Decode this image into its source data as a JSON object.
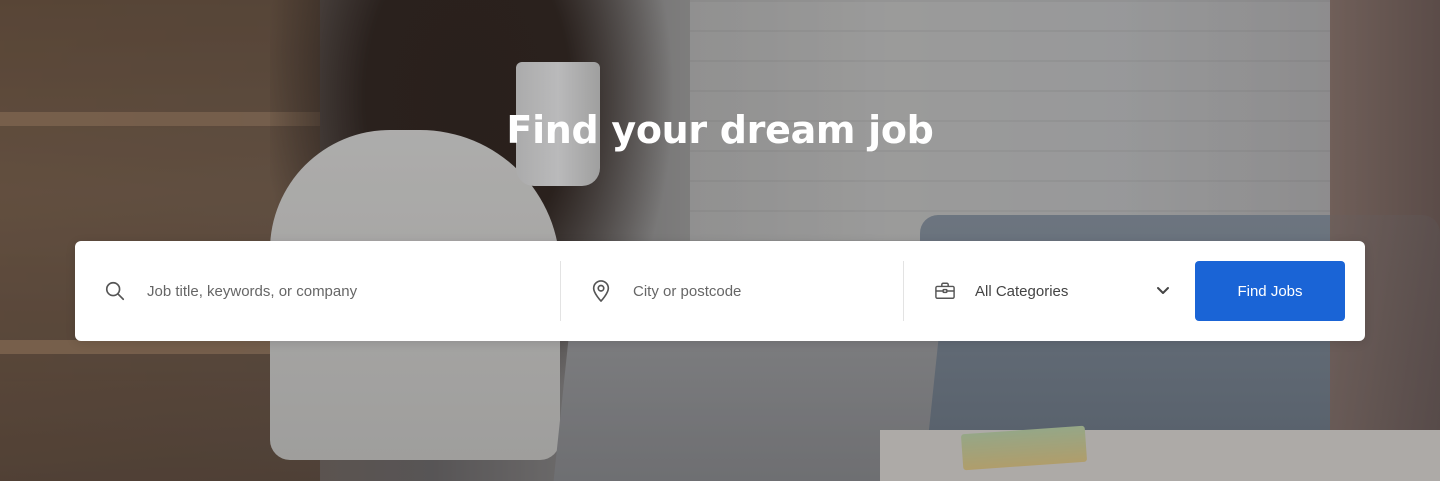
{
  "hero": {
    "title": "Find your dream job"
  },
  "search": {
    "keyword": {
      "icon": "search-icon",
      "placeholder": "Job title, keywords, or company",
      "value": ""
    },
    "location": {
      "icon": "location-pin-icon",
      "placeholder": "City or postcode",
      "value": ""
    },
    "category": {
      "icon": "briefcase-icon",
      "selected": "All Categories",
      "dropdown_icon": "chevron-down-icon"
    },
    "submit_label": "Find Jobs"
  },
  "colors": {
    "primary_button": "#1a64d6",
    "title_text": "#ffffff",
    "panel_background": "#ffffff"
  }
}
